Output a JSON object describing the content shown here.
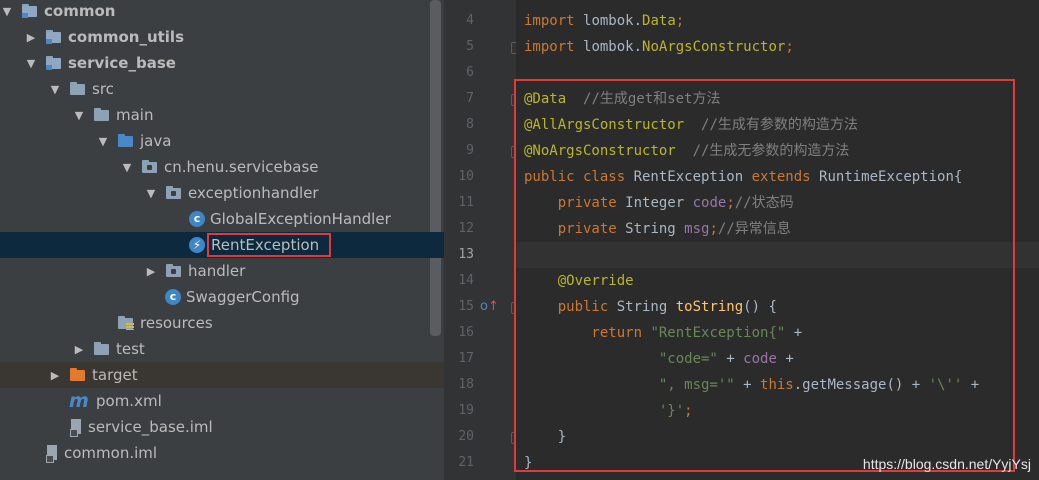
{
  "tree": {
    "items": [
      {
        "label": "common",
        "arrow": "▼",
        "icon": "module-folder-icon",
        "indent": 0,
        "bold": true
      },
      {
        "label": "common_utils",
        "arrow": "▶",
        "icon": "module-folder-icon",
        "indent": 1,
        "bold": true
      },
      {
        "label": "service_base",
        "arrow": "▼",
        "icon": "module-folder-icon",
        "indent": 1,
        "bold": true
      },
      {
        "label": "src",
        "arrow": "▼",
        "icon": "folder-icon",
        "indent": 2
      },
      {
        "label": "main",
        "arrow": "▼",
        "icon": "folder-icon",
        "indent": 3
      },
      {
        "label": "java",
        "arrow": "▼",
        "icon": "source-folder-icon",
        "indent": 4
      },
      {
        "label": "cn.henu.servicebase",
        "arrow": "▼",
        "icon": "package-icon",
        "indent": 5
      },
      {
        "label": "exceptionhandler",
        "arrow": "▼",
        "icon": "package-icon",
        "indent": 6
      },
      {
        "label": "GlobalExceptionHandler",
        "arrow": "",
        "icon": "class-icon",
        "indent": 7
      },
      {
        "label": "RentException",
        "arrow": "",
        "icon": "exception-class-icon",
        "indent": 7,
        "selected": true,
        "boxed": true
      },
      {
        "label": "handler",
        "arrow": "▶",
        "icon": "package-icon",
        "indent": 6
      },
      {
        "label": "SwaggerConfig",
        "arrow": "",
        "icon": "class-icon",
        "indent": 6
      },
      {
        "label": "resources",
        "arrow": "",
        "icon": "resources-folder-icon",
        "indent": 4
      },
      {
        "label": "test",
        "arrow": "▶",
        "icon": "folder-icon",
        "indent": 3
      },
      {
        "label": "target",
        "arrow": "▶",
        "icon": "target-folder-icon",
        "indent": 2,
        "target": true
      },
      {
        "label": "pom.xml",
        "arrow": "",
        "icon": "maven-icon",
        "indent": 2
      },
      {
        "label": "service_base.iml",
        "arrow": "",
        "icon": "iml-file-icon",
        "indent": 2
      },
      {
        "label": "common.iml",
        "arrow": "",
        "icon": "iml-file-icon",
        "indent": 1
      }
    ]
  },
  "editor": {
    "current_line": "13",
    "lines": [
      {
        "num": "4",
        "tokens": [
          {
            "t": "import ",
            "c": "kw"
          },
          {
            "t": "lombok.",
            "c": ""
          },
          {
            "t": "Data",
            "c": "ann"
          },
          {
            "t": ";",
            "c": "kw"
          }
        ]
      },
      {
        "num": "5",
        "tokens": [
          {
            "t": "import ",
            "c": "kw"
          },
          {
            "t": "lombok.",
            "c": ""
          },
          {
            "t": "NoArgsConstructor",
            "c": "ann"
          },
          {
            "t": ";",
            "c": "kw"
          }
        ]
      },
      {
        "num": "6",
        "tokens": []
      },
      {
        "num": "7",
        "tokens": [
          {
            "t": "@Data",
            "c": "ann"
          },
          {
            "t": "  //生成get和set方法",
            "c": "cmt"
          }
        ]
      },
      {
        "num": "8",
        "tokens": [
          {
            "t": "@AllArgsConstructor",
            "c": "ann"
          },
          {
            "t": "  //生成有参数的构造方法",
            "c": "cmt"
          }
        ]
      },
      {
        "num": "9",
        "tokens": [
          {
            "t": "@NoArgsConstructor",
            "c": "ann"
          },
          {
            "t": "  //生成无参数的构造方法",
            "c": "cmt"
          }
        ]
      },
      {
        "num": "10",
        "tokens": [
          {
            "t": "public class ",
            "c": "kw"
          },
          {
            "t": "RentException ",
            "c": "cls"
          },
          {
            "t": "extends ",
            "c": "kw"
          },
          {
            "t": "RuntimeException{",
            "c": "cls"
          }
        ]
      },
      {
        "num": "11",
        "tokens": [
          {
            "t": "    private ",
            "c": "kw"
          },
          {
            "t": "Integer ",
            "c": "cls"
          },
          {
            "t": "code",
            "c": "fld"
          },
          {
            "t": ";",
            "c": "kw"
          },
          {
            "t": "//状态码",
            "c": "cmt"
          }
        ]
      },
      {
        "num": "12",
        "tokens": [
          {
            "t": "    private ",
            "c": "kw"
          },
          {
            "t": "String ",
            "c": "cls"
          },
          {
            "t": "msg",
            "c": "fld"
          },
          {
            "t": ";",
            "c": "kw"
          },
          {
            "t": "//异常信息",
            "c": "cmt"
          }
        ]
      },
      {
        "num": "13",
        "tokens": []
      },
      {
        "num": "14",
        "tokens": [
          {
            "t": "    @Override",
            "c": "ann"
          }
        ]
      },
      {
        "num": "15",
        "tokens": [
          {
            "t": "    public ",
            "c": "kw"
          },
          {
            "t": "String ",
            "c": "cls"
          },
          {
            "t": "toString",
            "c": "fn"
          },
          {
            "t": "() {",
            "c": "cls"
          }
        ]
      },
      {
        "num": "16",
        "tokens": [
          {
            "t": "        return ",
            "c": "kw"
          },
          {
            "t": "\"RentException{\"",
            "c": "str"
          },
          {
            "t": " +",
            "c": "cls"
          }
        ]
      },
      {
        "num": "17",
        "tokens": [
          {
            "t": "                ",
            "c": ""
          },
          {
            "t": "\"code=\"",
            "c": "str"
          },
          {
            "t": " + ",
            "c": "cls"
          },
          {
            "t": "code",
            "c": "fld"
          },
          {
            "t": " +",
            "c": "cls"
          }
        ]
      },
      {
        "num": "18",
        "tokens": [
          {
            "t": "                ",
            "c": ""
          },
          {
            "t": "\", msg='\"",
            "c": "str"
          },
          {
            "t": " + ",
            "c": "cls"
          },
          {
            "t": "this",
            "c": "kw"
          },
          {
            "t": ".getMessage() + ",
            "c": "cls"
          },
          {
            "t": "'\\''",
            "c": "str"
          },
          {
            "t": " +",
            "c": "cls"
          }
        ]
      },
      {
        "num": "19",
        "tokens": [
          {
            "t": "                ",
            "c": ""
          },
          {
            "t": "'}'",
            "c": "str"
          },
          {
            "t": ";",
            "c": "kw"
          }
        ]
      },
      {
        "num": "20",
        "tokens": [
          {
            "t": "    }",
            "c": "cls"
          }
        ]
      },
      {
        "num": "21",
        "tokens": [
          {
            "t": "}",
            "c": "cls"
          }
        ]
      }
    ]
  },
  "gutter_marker": "overrides-method-icon",
  "watermark": "https://blog.csdn.net/YyjYsj"
}
